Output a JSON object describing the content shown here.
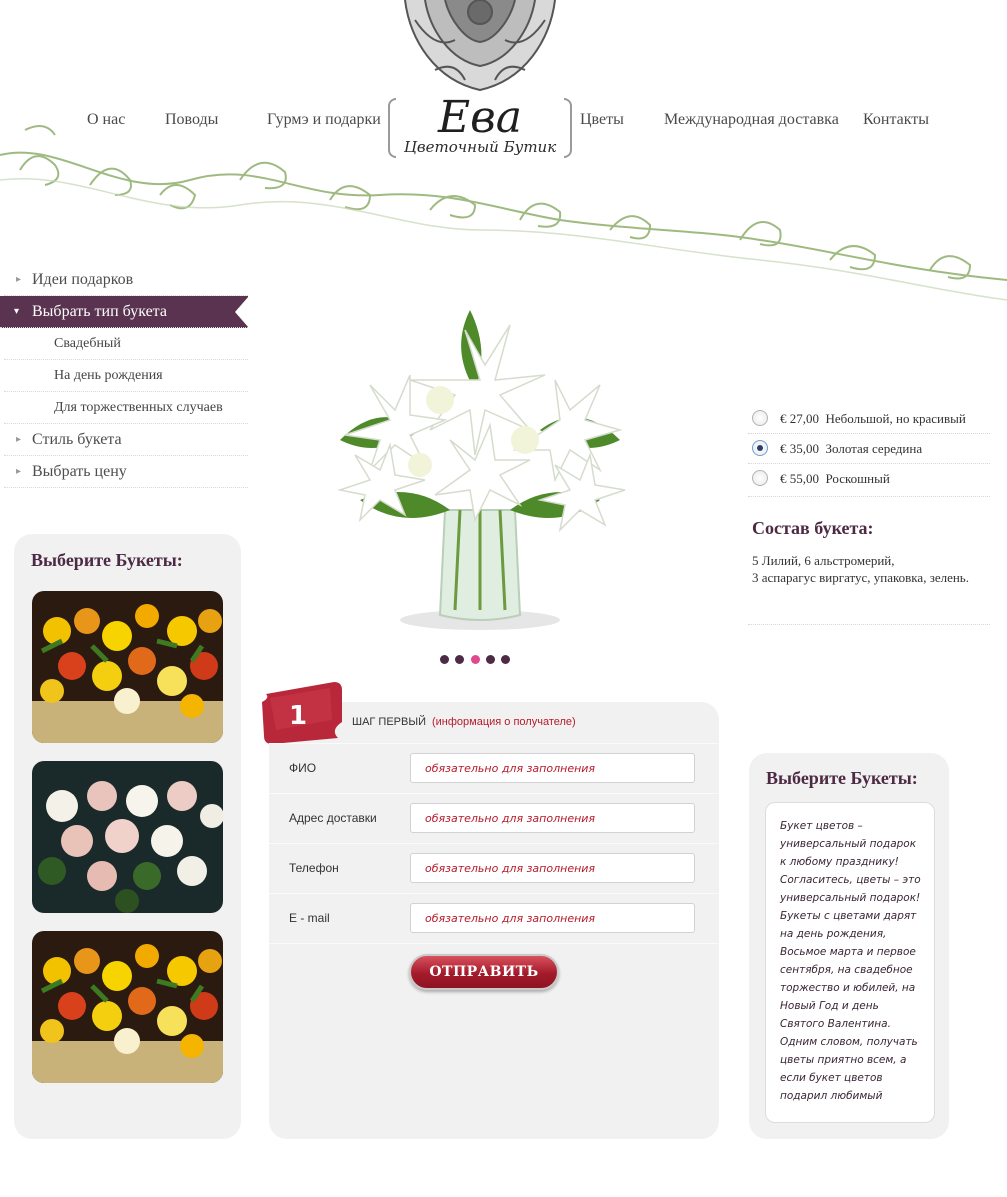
{
  "nav": {
    "left": [
      "О нас",
      "Поводы",
      "Гурмэ и подарки"
    ],
    "right": [
      "Цветы",
      "Международная доставка",
      "Контакты"
    ]
  },
  "logo": {
    "main": "Ева",
    "sub": "Цветочный Бутик"
  },
  "sidebar": {
    "items": [
      {
        "label": "Идеи подарков"
      },
      {
        "label": "Выбрать тип букета"
      },
      {
        "label": "Свадебный"
      },
      {
        "label": "На день рождения"
      },
      {
        "label": "Для торжественных случаев"
      },
      {
        "label": "Стиль букета"
      },
      {
        "label": "Выбрать цену"
      }
    ]
  },
  "left_panel": {
    "title": "Выберите Букеты:"
  },
  "slider": {
    "count": 5,
    "active_index": 2
  },
  "form": {
    "step_number": "1",
    "step_label": "ШАГ ПЕРВЫЙ",
    "step_note": "(информация о получателе)",
    "fields": [
      {
        "label": "ФИО",
        "placeholder": "обязательно для заполнения"
      },
      {
        "label": "Адрес доставки",
        "placeholder": "обязательно для заполнения"
      },
      {
        "label": "Телефон",
        "placeholder": "обязательно для заполнения"
      },
      {
        "label": "E - mail",
        "placeholder": "обязательно для заполнения"
      }
    ],
    "submit_label": "ОТПРАВИТЬ"
  },
  "price_options": [
    {
      "price": "€ 27,00",
      "label": "Небольшой, но красивый",
      "selected": false
    },
    {
      "price": "€ 35,00",
      "label": "Золотая середина",
      "selected": true
    },
    {
      "price": "€ 55,00",
      "label": "Роскошный",
      "selected": false
    }
  ],
  "composition": {
    "title": "Состав букета:",
    "line1": "5 Лилий, 6 альстромерий,",
    "line2": "3 аспарагус виргатус, упаковка, зелень."
  },
  "right_panel": {
    "title": "Выберите Букеты:",
    "text": "Букет цветов – универсальный подарок к любому празднику! Согласитесь, цветы – это универсальный подарок! Букеты с цветами дарят на день рождения, Восьмое марта и первое сентября, на свадебное торжество и юбилей, на Новый Год и день Святого Валентина. Одним словом, получать цветы приятно всем, а если букет цветов подарил любимый"
  },
  "colors": {
    "accent": "#5a3350",
    "title": "#4c2a44",
    "red": "#b51c2b",
    "panel": "#f1f1f1",
    "dot_active": "#e0498e"
  }
}
